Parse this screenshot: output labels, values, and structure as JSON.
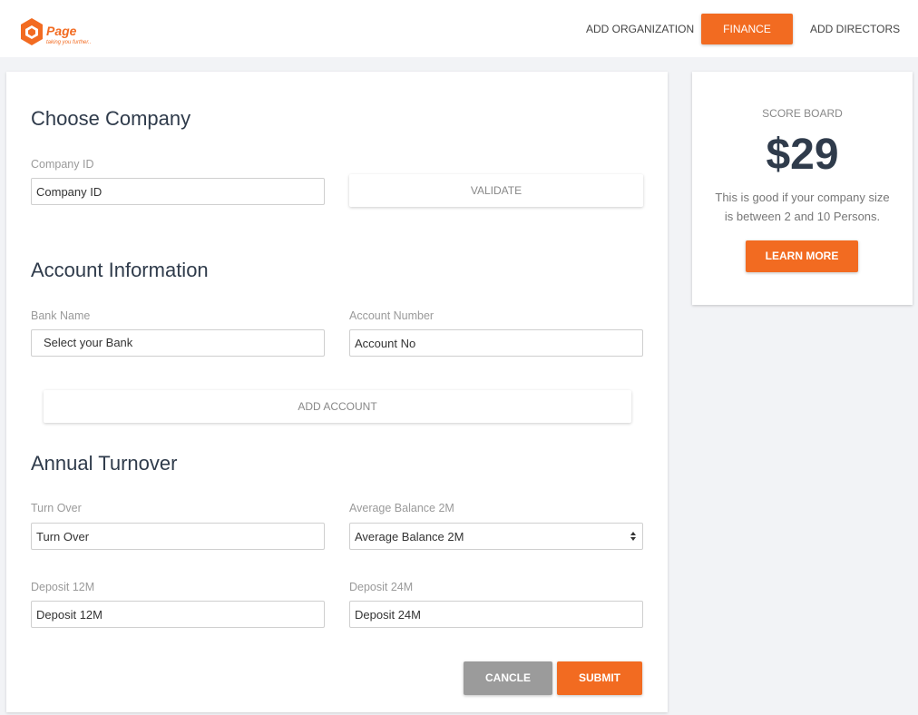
{
  "brand": {
    "name": "Page",
    "tagline": "taking you further..",
    "color": "#f26b21"
  },
  "nav": {
    "items": [
      {
        "label": "ADD ORGANIZATION"
      },
      {
        "label": "FINANCE",
        "active": true
      },
      {
        "label": "ADD DIRECTORS"
      }
    ]
  },
  "choose_company": {
    "title": "Choose Company",
    "company_id_label": "Company ID",
    "company_id_placeholder": "Company ID",
    "validate_label": "VALIDATE"
  },
  "account_info": {
    "title": "Account Information",
    "bank_name_label": "Bank Name",
    "bank_select_value": "Select your Bank",
    "account_number_label": "Account Number",
    "account_number_placeholder": "Account No",
    "add_account_label": "ADD ACCOUNT"
  },
  "annual_turnover": {
    "title": "Annual Turnover",
    "turnover_label": "Turn Over",
    "turnover_placeholder": "Turn Over",
    "avg_balance_label": "Average Balance 2M",
    "avg_balance_placeholder": "Average Balance 2M",
    "deposit12_label": "Deposit 12M",
    "deposit12_placeholder": "Deposit 12M",
    "deposit24_label": "Deposit 24M",
    "deposit24_placeholder": "Deposit 24M"
  },
  "actions": {
    "cancel_label": "CANCLE",
    "submit_label": "SUBMIT"
  },
  "scoreboard": {
    "title": "SCORE BOARD",
    "value": "$29",
    "description": "This is good if your company size is between 2 and 10 Persons.",
    "learn_more_label": "LEARN MORE"
  }
}
